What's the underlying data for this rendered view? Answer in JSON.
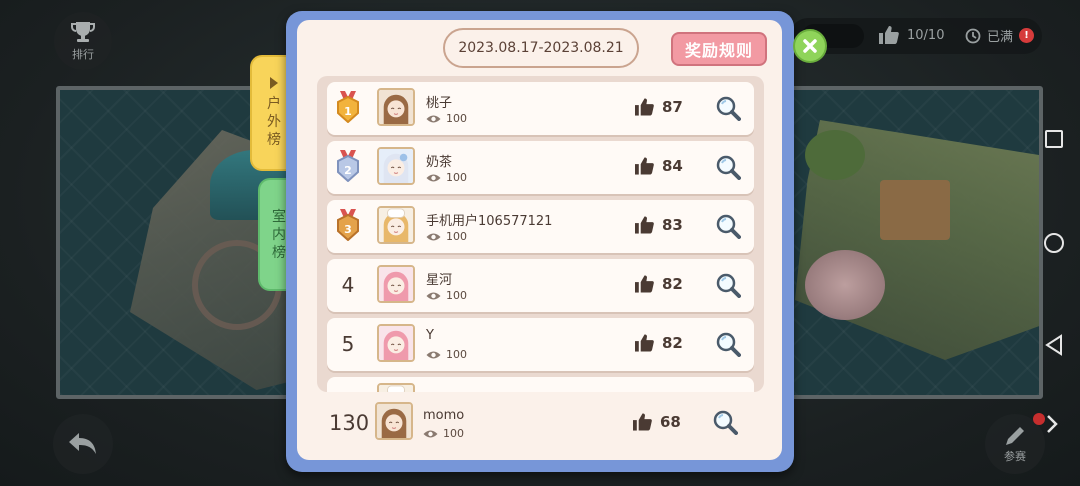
{
  "hud": {
    "rank_label": "排行",
    "likes_count": "10/10",
    "full_label": "已满",
    "full_badge": "!",
    "enter_label": "参赛"
  },
  "modal": {
    "date_range": "2023.08.17-2023.08.21",
    "rules_label": "奖励规则",
    "tabs": [
      {
        "label": "户外榜",
        "chars": [
          "户",
          "外",
          "榜"
        ],
        "active": true
      },
      {
        "label": "室内榜",
        "chars": [
          "室",
          "内",
          "榜"
        ],
        "active": false
      }
    ],
    "rows": [
      {
        "rank": "1",
        "name": "桃子",
        "views": "100",
        "likes": "87",
        "avatar": "brown-hair",
        "medal": "gold"
      },
      {
        "rank": "2",
        "name": "奶茶",
        "views": "100",
        "likes": "84",
        "avatar": "white-hair",
        "medal": "silver"
      },
      {
        "rank": "3",
        "name": "手机用户106577121",
        "views": "100",
        "likes": "83",
        "avatar": "chef-hat",
        "medal": "bronze"
      },
      {
        "rank": "4",
        "name": "星河",
        "views": "100",
        "likes": "82",
        "avatar": "pink-hair",
        "medal": ""
      },
      {
        "rank": "5",
        "name": "Y",
        "views": "100",
        "likes": "82",
        "avatar": "pink-hair",
        "medal": ""
      }
    ],
    "my_row": {
      "rank": "130",
      "name": "momo",
      "views": "100",
      "likes": "68",
      "avatar": "brown-hair"
    }
  },
  "colors": {
    "modal_frame": "#7796d8",
    "modal_bg": "#fbf1ea",
    "rules_button": "#f29aa3",
    "tab_outdoor": "#f8d45a",
    "tab_indoor": "#7fd48a",
    "close_button": "#8fd45a"
  }
}
